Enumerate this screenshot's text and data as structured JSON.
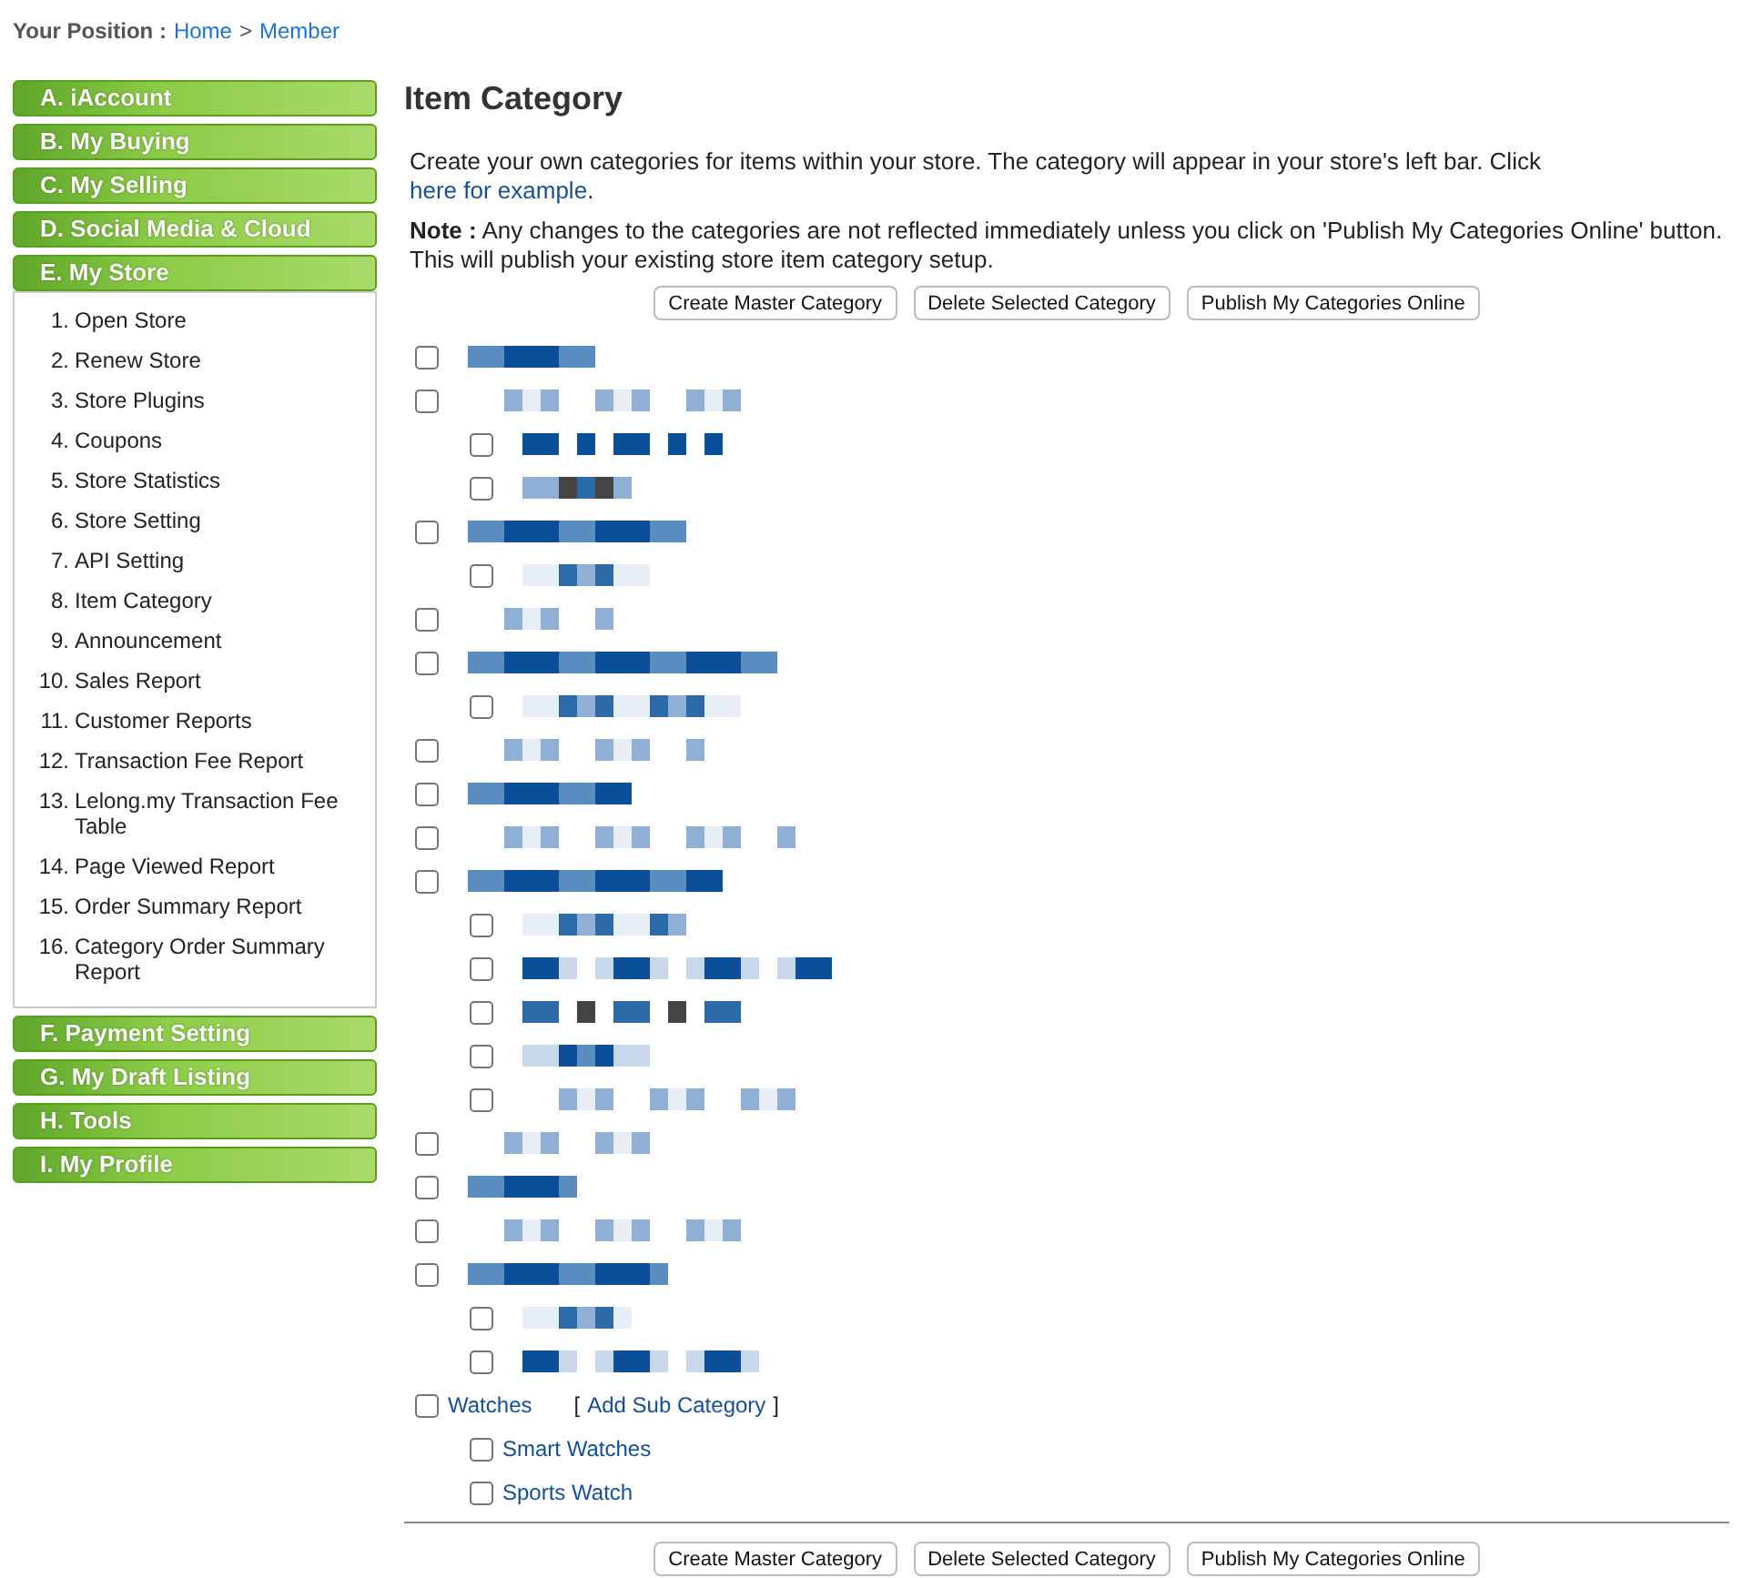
{
  "breadcrumb": {
    "label": "Your Position :",
    "links": [
      {
        "text": "Home"
      },
      {
        "text": "Member"
      }
    ],
    "separator": ">"
  },
  "sidebar": {
    "sections": [
      {
        "label": "A. iAccount"
      },
      {
        "label": "B. My Buying"
      },
      {
        "label": "C. My Selling"
      },
      {
        "label": "D. Social Media & Cloud"
      },
      {
        "label": "E. My Store",
        "items": [
          {
            "number": "1.",
            "label": "Open Store"
          },
          {
            "number": "2.",
            "label": "Renew Store"
          },
          {
            "number": "3.",
            "label": "Store Plugins"
          },
          {
            "number": "4.",
            "label": "Coupons"
          },
          {
            "number": "5.",
            "label": "Store Statistics"
          },
          {
            "number": "6.",
            "label": "Store Setting"
          },
          {
            "number": "7.",
            "label": "API Setting"
          },
          {
            "number": "8.",
            "label": "Item Category"
          },
          {
            "number": "9.",
            "label": "Announcement"
          },
          {
            "number": "10.",
            "label": "Sales Report"
          },
          {
            "number": "11.",
            "label": "Customer Reports"
          },
          {
            "number": "12.",
            "label": "Transaction Fee Report"
          },
          {
            "number": "13.",
            "label": "Lelong.my Transaction Fee Table"
          },
          {
            "number": "14.",
            "label": "Page Viewed Report"
          },
          {
            "number": "15.",
            "label": "Order Summary Report"
          },
          {
            "number": "16.",
            "label": "Category Order Summary Report"
          }
        ]
      },
      {
        "label": "F. Payment Setting"
      },
      {
        "label": "G. My Draft Listing"
      },
      {
        "label": "H. Tools"
      },
      {
        "label": "I. My Profile"
      }
    ]
  },
  "main": {
    "title": "Item Category",
    "intro": "Create your own categories for items within your store. The category will appear in your store's left bar. Click ",
    "intro_link": "here for example",
    "intro_end": ".",
    "note": "**Note :** Any changes to the categories are not reflected immediately unless you click on 'Publish My Categories Online' button. This will publish your existing store item category setup.",
    "buttons": [
      "Create Master Category",
      "Delete Selected Category",
      "Publish My Categories Online"
    ],
    "categories": [
      {
        "kind": "pixelated",
        "checked": false
      },
      {
        "kind": "pixelated",
        "checked": false,
        "children": [
          {
            "kind": "pixelated",
            "checked": false
          },
          {
            "kind": "pixelated",
            "checked": false
          }
        ]
      },
      {
        "kind": "pixelated",
        "checked": false,
        "children": [
          {
            "kind": "pixelated",
            "checked": false
          }
        ]
      },
      {
        "kind": "pixelated",
        "checked": false
      },
      {
        "kind": "pixelated",
        "checked": false,
        "children": [
          {
            "kind": "pixelated",
            "checked": false
          }
        ]
      },
      {
        "kind": "pixelated",
        "checked": false
      },
      {
        "kind": "pixelated",
        "checked": false
      },
      {
        "kind": "pixelated",
        "checked": false
      },
      {
        "kind": "pixelated",
        "checked": false,
        "children": [
          {
            "kind": "pixelated",
            "checked": false
          },
          {
            "kind": "pixelated",
            "checked": false
          },
          {
            "kind": "pixelated",
            "checked": false
          },
          {
            "kind": "pixelated",
            "checked": false
          },
          {
            "kind": "pixelated",
            "checked": false
          }
        ]
      },
      {
        "kind": "pixelated",
        "checked": false
      },
      {
        "kind": "pixelated",
        "checked": false
      },
      {
        "kind": "pixelated",
        "checked": false
      },
      {
        "kind": "pixelated",
        "checked": false,
        "children": [
          {
            "kind": "pixelated",
            "checked": false
          },
          {
            "kind": "pixelated",
            "checked": false
          }
        ]
      },
      {
        "kind": "named",
        "name": "Watches",
        "checked": false,
        "add_link": {
          "open": "[",
          "label": "Add Sub Category",
          "close": "]"
        },
        "children": [
          {
            "kind": "named",
            "name": "Smart Watches",
            "checked": false
          },
          {
            "kind": "named",
            "name": "Sports Watch",
            "checked": false
          }
        ]
      }
    ],
    "bottom_buttons": [
      "Create Master Category",
      "Delete Selected Category",
      "Publish My Categories Online"
    ]
  }
}
